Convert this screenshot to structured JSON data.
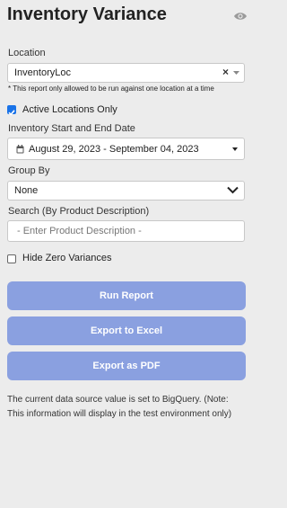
{
  "header": {
    "title": "Inventory Variance",
    "visibility_icon": "eye-icon"
  },
  "location": {
    "label": "Location",
    "value": "InventoryLoc",
    "clear_glyph": "×",
    "note": "* This report only allowed to be run against one location at a time"
  },
  "active_locations": {
    "label": "Active Locations Only",
    "checked": true
  },
  "date_range": {
    "label": "Inventory Start and End Date",
    "value": "August 29, 2023 - September 04, 2023"
  },
  "group_by": {
    "label": "Group By",
    "value": "None"
  },
  "search": {
    "label": "Search (By Product Description)",
    "placeholder": "- Enter Product Description -"
  },
  "hide_zero": {
    "label": "Hide Zero Variances",
    "checked": false
  },
  "buttons": {
    "run_report": "Run Report",
    "export_excel": "Export to Excel",
    "export_pdf": "Export as PDF"
  },
  "info_text": "The current data source value is set to BigQuery. (Note: This information will display in the test environment only)",
  "colors": {
    "button_bg": "#8aa0e0",
    "checkbox_accent": "#1a73e8",
    "panel_bg": "#ececec"
  }
}
